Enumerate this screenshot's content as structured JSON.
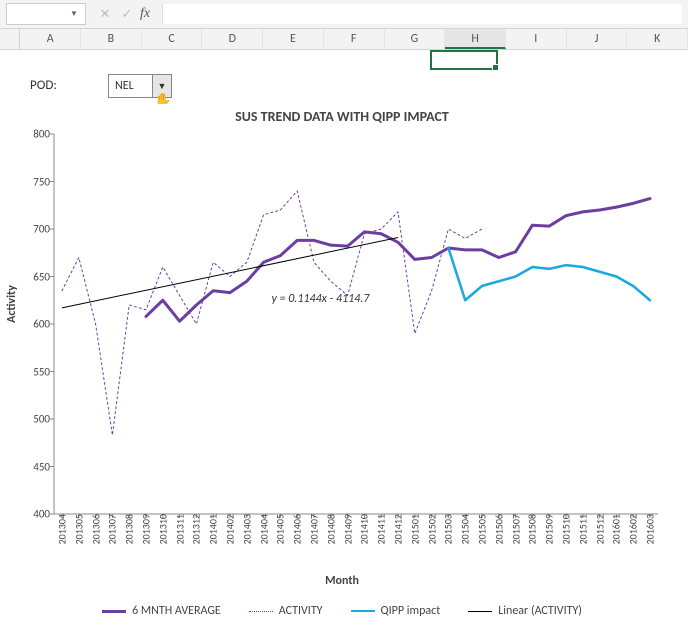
{
  "app": {
    "name_box": "",
    "fx_label": "fx",
    "columns": [
      "A",
      "B",
      "C",
      "D",
      "E",
      "F",
      "G",
      "H",
      "I",
      "J",
      "K"
    ],
    "selected_column_index": 7
  },
  "controls": {
    "pod_label": "POD:",
    "dropdown_value": "NEL"
  },
  "chart_data": {
    "type": "line",
    "title": "SUS TREND DATA WITH QIPP IMPACT",
    "xlabel": "Month",
    "ylabel": "Activity",
    "ylim": [
      400,
      800
    ],
    "yticks": [
      400,
      450,
      500,
      550,
      600,
      650,
      700,
      750,
      800
    ],
    "categories": [
      "201304",
      "201305",
      "201306",
      "201307",
      "201308",
      "201309",
      "201310",
      "201311",
      "201312",
      "201401",
      "201402",
      "201403",
      "201404",
      "201405",
      "201406",
      "201407",
      "201408",
      "201409",
      "201410",
      "201411",
      "201412",
      "201501",
      "201502",
      "201503",
      "201504",
      "201505",
      "201506",
      "201507",
      "201508",
      "201509",
      "201510",
      "201511",
      "201512",
      "201601",
      "201602",
      "201603"
    ],
    "series": [
      {
        "name": "6 MNTH AVERAGE",
        "color": "#6b3fa0",
        "width": 3,
        "dash": "",
        "values": [
          null,
          null,
          null,
          null,
          null,
          608,
          625,
          603,
          620,
          635,
          633,
          645,
          665,
          672,
          688,
          688,
          683,
          682,
          697,
          695,
          686,
          668,
          670,
          680,
          678,
          678,
          670,
          676,
          704,
          703,
          714,
          718,
          720,
          723,
          727,
          732
        ]
      },
      {
        "name": "ACTIVITY",
        "color": "#6b3fa0",
        "width": 1,
        "dash": "2 3",
        "values": [
          635,
          670,
          600,
          483,
          620,
          615,
          660,
          630,
          600,
          665,
          650,
          665,
          715,
          720,
          740,
          665,
          645,
          630,
          695,
          700,
          718,
          590,
          635,
          700,
          690,
          700,
          null,
          null,
          null,
          null,
          null,
          null,
          null,
          null,
          null,
          null
        ]
      },
      {
        "name": "QIPP impact",
        "color": "#1ba8e0",
        "width": 2.5,
        "dash": "",
        "values": [
          null,
          null,
          null,
          null,
          null,
          null,
          null,
          null,
          null,
          null,
          null,
          null,
          null,
          null,
          null,
          null,
          null,
          null,
          null,
          null,
          null,
          null,
          null,
          680,
          625,
          640,
          645,
          650,
          660,
          658,
          662,
          660,
          655,
          650,
          640,
          625
        ]
      },
      {
        "name": "Linear (ACTIVITY)",
        "color": "#000000",
        "width": 1,
        "dash": "",
        "is_trendline": true,
        "endpoints": {
          "x0": 0,
          "y0": 617,
          "x1": 20,
          "y1": 691
        }
      }
    ],
    "trend_equation": "y = 0.1144x - 4114.7",
    "trend_equation_pos": {
      "x_rel": 0.36,
      "y_rel": 0.415
    }
  }
}
